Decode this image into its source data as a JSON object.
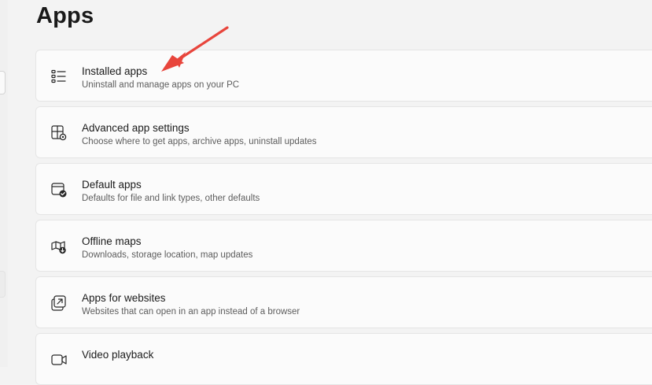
{
  "page": {
    "title": "Apps"
  },
  "items": [
    {
      "title": "Installed apps",
      "subtitle": "Uninstall and manage apps on your PC",
      "icon": "list-icon"
    },
    {
      "title": "Advanced app settings",
      "subtitle": "Choose where to get apps, archive apps, uninstall updates",
      "icon": "app-settings-icon"
    },
    {
      "title": "Default apps",
      "subtitle": "Defaults for file and link types, other defaults",
      "icon": "default-apps-icon"
    },
    {
      "title": "Offline maps",
      "subtitle": "Downloads, storage location, map updates",
      "icon": "offline-map-icon"
    },
    {
      "title": "Apps for websites",
      "subtitle": "Websites that can open in an app instead of a browser",
      "icon": "open-in-app-icon"
    },
    {
      "title": "Video playback",
      "subtitle": "",
      "icon": "video-camera-icon"
    }
  ],
  "colors": {
    "annotation_arrow": "#e8453c",
    "card_background": "#fbfbfb",
    "page_background": "#f3f3f3"
  }
}
